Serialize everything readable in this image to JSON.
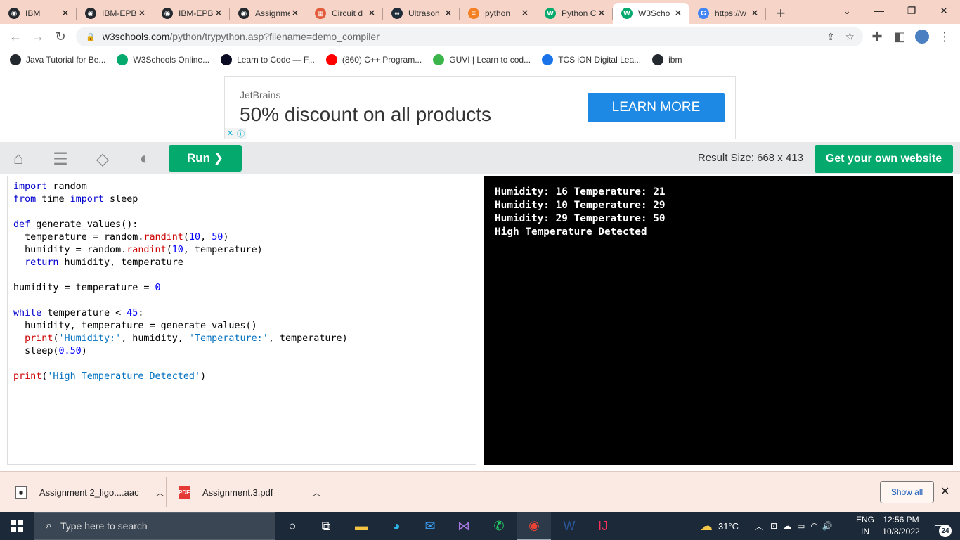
{
  "browser": {
    "tabs": [
      {
        "title": "IBM",
        "icon": "github-icon",
        "color": "#24292f",
        "glyph": "◉"
      },
      {
        "title": "IBM-EPB",
        "icon": "github-icon",
        "color": "#24292f",
        "glyph": "◉"
      },
      {
        "title": "IBM-EPB",
        "icon": "github-icon",
        "color": "#24292f",
        "glyph": "◉"
      },
      {
        "title": "Assignment",
        "icon": "github-icon",
        "color": "#24292f",
        "glyph": "◉"
      },
      {
        "title": "Circuit d",
        "icon": "tinkercad-icon",
        "color": "#e25c3b",
        "glyph": "▦"
      },
      {
        "title": "Ultrason",
        "icon": "arduino-icon",
        "color": "#1f2d3a",
        "glyph": "∞"
      },
      {
        "title": "python",
        "icon": "stackoverflow-icon",
        "color": "#f48024",
        "glyph": "≡"
      },
      {
        "title": "Python C",
        "icon": "w3schools-icon",
        "color": "#04aa6d",
        "glyph": "W"
      },
      {
        "title": "W3Scho",
        "icon": "w3schools-icon",
        "color": "#04aa6d",
        "glyph": "W",
        "active": true
      },
      {
        "title": "https://w",
        "icon": "google-icon",
        "color": "#4285f4",
        "glyph": "G"
      }
    ],
    "new_tab_label": "+",
    "controls": {
      "chevron": "⌄",
      "minimize": "—",
      "restore": "❐",
      "close": "✕"
    },
    "address": {
      "host": "w3schools.com",
      "path": "/python/trypython.asp?filename=demo_compiler"
    },
    "bookmarks": [
      {
        "label": "Java Tutorial for Be...",
        "icon": "github-icon",
        "color": "#24292f"
      },
      {
        "label": "W3Schools Online...",
        "icon": "w3schools-icon",
        "color": "#04aa6d"
      },
      {
        "label": "Learn to Code — F...",
        "icon": "freecodecamp-icon",
        "color": "#0a0a23"
      },
      {
        "label": "(860) C++ Program...",
        "icon": "youtube-icon",
        "color": "#ff0000"
      },
      {
        "label": "GUVI | Learn to cod...",
        "icon": "guvi-icon",
        "color": "#3bb54a"
      },
      {
        "label": "TCS iON Digital Lea...",
        "icon": "tcs-icon",
        "color": "#1a73e8"
      },
      {
        "label": "ibm",
        "icon": "github-icon",
        "color": "#24292f"
      }
    ]
  },
  "ad": {
    "brand": "JetBrains",
    "headline": "50% discount on all products",
    "cta": "LEARN MORE"
  },
  "toolbar": {
    "run_label": "Run ❯",
    "result_size": "Result Size: 668 x 413",
    "get_website": "Get your own website"
  },
  "editor": {
    "lines": [
      [
        {
          "t": "import",
          "c": "kw"
        },
        {
          "t": " random"
        }
      ],
      [
        {
          "t": "from",
          "c": "kw"
        },
        {
          "t": " time "
        },
        {
          "t": "import",
          "c": "kw"
        },
        {
          "t": " sleep"
        }
      ],
      [],
      [
        {
          "t": "def",
          "c": "kw"
        },
        {
          "t": " generate_values():"
        }
      ],
      [
        {
          "t": "  temperature = random."
        },
        {
          "t": "randint",
          "c": "fn"
        },
        {
          "t": "("
        },
        {
          "t": "10",
          "c": "num"
        },
        {
          "t": ", "
        },
        {
          "t": "50",
          "c": "num"
        },
        {
          "t": ")"
        }
      ],
      [
        {
          "t": "  humidity = random."
        },
        {
          "t": "randint",
          "c": "fn"
        },
        {
          "t": "("
        },
        {
          "t": "10",
          "c": "num"
        },
        {
          "t": ", temperature)"
        }
      ],
      [
        {
          "t": "  "
        },
        {
          "t": "return",
          "c": "kw"
        },
        {
          "t": " humidity, temperature"
        }
      ],
      [],
      [
        {
          "t": "humidity = temperature = "
        },
        {
          "t": "0",
          "c": "num"
        }
      ],
      [],
      [
        {
          "t": "while",
          "c": "kw"
        },
        {
          "t": " temperature < "
        },
        {
          "t": "45",
          "c": "num"
        },
        {
          "t": ":"
        }
      ],
      [
        {
          "t": "  humidity, temperature = generate_values()"
        }
      ],
      [
        {
          "t": "  "
        },
        {
          "t": "print",
          "c": "fn"
        },
        {
          "t": "("
        },
        {
          "t": "'Humidity:'",
          "c": "str2"
        },
        {
          "t": ", humidity, "
        },
        {
          "t": "'Temperature:'",
          "c": "str2"
        },
        {
          "t": ", temperature)"
        }
      ],
      [
        {
          "t": "  sleep("
        },
        {
          "t": "0.50",
          "c": "num"
        },
        {
          "t": ")"
        }
      ],
      [],
      [
        {
          "t": "print",
          "c": "fn"
        },
        {
          "t": "("
        },
        {
          "t": "'High Temperature Detected'",
          "c": "str2"
        },
        {
          "t": ")"
        }
      ]
    ]
  },
  "result": {
    "lines": [
      "Humidity: 16 Temperature: 21",
      "Humidity: 10 Temperature: 29",
      "Humidity: 29 Temperature: 50",
      "High Temperature Detected"
    ]
  },
  "downloads": {
    "items": [
      {
        "name": "Assignment 2_ligo....aac",
        "icon": "audio-file-icon"
      },
      {
        "name": "Assignment.3.pdf",
        "icon": "pdf-file-icon"
      }
    ],
    "show_all": "Show all"
  },
  "taskbar": {
    "search_placeholder": "Type here to search",
    "weather": "31°C",
    "lang_top": "ENG",
    "lang_bottom": "IN",
    "time": "12:56 PM",
    "date": "10/8/2022",
    "notifications": "24"
  }
}
